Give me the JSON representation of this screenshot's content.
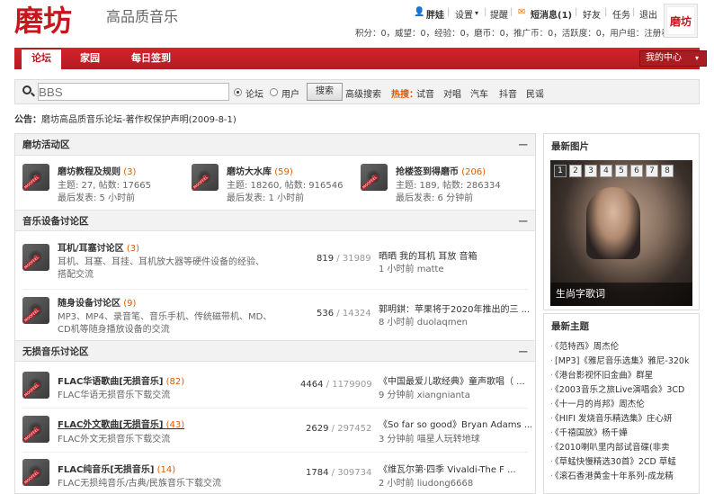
{
  "header": {
    "logo_text": "磨坊",
    "subtitle": "高品质音乐",
    "user": "胖娃",
    "menu": [
      "设置",
      "提醒",
      "短消息(1)",
      "好友",
      "任务",
      "退出"
    ],
    "stats": "积分：0，威望：0，经验：0，磨币：0，推广币：0，活跃度：0，用户组：注册看看",
    "avatar_text": "磨坊"
  },
  "nav": {
    "items": [
      "论坛",
      "家园",
      "每日签到"
    ],
    "my_center": "我的中心"
  },
  "search": {
    "placeholder": "BBS",
    "opt_forum": "论坛",
    "opt_user": "用户",
    "button": "搜索",
    "advanced": "高级搜索",
    "hot_label": "热搜：",
    "hot": [
      "试音",
      "对唱",
      "汽车",
      "抖音",
      "民谣"
    ]
  },
  "notice": {
    "label": "公告：",
    "text": "磨坊高品质音乐论坛-著作权保护声明(2009-8-1)"
  },
  "sec1": {
    "title": "磨坊活动区",
    "forums": [
      {
        "name": "磨坊教程及规则",
        "count": "(3)",
        "stats": "主题: 27, 帖数: 17665",
        "last": "最后发表: 5 小时前"
      },
      {
        "name": "磨坊大水库",
        "count": "(59)",
        "stats": "主题: 18260, 帖数: 916546",
        "last": "最后发表: 1 小时前"
      },
      {
        "name": "抢楼签到得磨币",
        "count": "(206)",
        "stats": "主题: 189, 帖数: 286334",
        "last": "最后发表: 6 分钟前"
      }
    ]
  },
  "sec2": {
    "title": "音乐设备讨论区",
    "forums": [
      {
        "name": "耳机/耳塞讨论区",
        "count": "(3)",
        "desc1": "耳机、耳塞、耳挂、耳机放大器等硬件设备的经验、",
        "desc2": "搭配交流",
        "topics": "819",
        "posts": "31989",
        "lt": "晒晒 我的耳机 耳放 音箱",
        "lm": "1 小时前 matte"
      },
      {
        "name": "随身设备讨论区",
        "count": "(9)",
        "desc1": "MP3、MP4、录音笔、音乐手机、传统磁带机、MD、",
        "desc2": "CD机等随身播放设备的交流",
        "topics": "536",
        "posts": "14324",
        "lt": "郭明錤：苹果将于2020年推出的三 ...",
        "lm": "8 小时前 duolaqmen"
      }
    ]
  },
  "sec3": {
    "title": "无损音乐讨论区",
    "forums": [
      {
        "name": "FLAC华语歌曲[无损音乐]",
        "count": "(82)",
        "desc1": "FLAC华语无损音乐下载交流",
        "topics": "4464",
        "posts": "1179909",
        "lt": "《中国最爱儿歌经典》童声歌唱（ ...",
        "lm": "9 分钟前 xiangnianta"
      },
      {
        "name": "FLAC外文歌曲[无损音乐]",
        "count": "(43)",
        "desc1": "FLAC外文无损音乐下载交流",
        "topics": "2629",
        "posts": "297452",
        "lt": "《So far so good》Bryan Adams ...",
        "lm": "3 分钟前 喵星人玩转地球"
      },
      {
        "name": "FLAC纯音乐[无损音乐]",
        "count": "(14)",
        "desc1": "FLAC无损纯音乐/古典/民族音乐下载交流",
        "topics": "1784",
        "posts": "309734",
        "lt": "《维瓦尔第·四季 Vivaldi-The F ...",
        "lm": "2 小时前 liudong6668"
      }
    ]
  },
  "side": {
    "pic_title": "最新图片",
    "pic_nums": [
      "1",
      "2",
      "3",
      "4",
      "5",
      "6",
      "7",
      "8"
    ],
    "pic_caption": "生尚字歌词",
    "new_title": "最新主题",
    "topics": [
      "《范特西》周杰伦",
      "[MP3]《雅尼音乐选集》雅尼-320k",
      "《港台影视怀旧金曲》群星",
      "《2003音乐之旅Live演唱会》3CD",
      "《十一月的肖邦》周杰伦",
      "《HIFI 发烧音乐精选集》庄心妍",
      "《千禧国放》杨千嬅",
      "《2010喇叭里内部试音碟(非卖",
      "《草蜢快慢精选30首》2CD 草蜢",
      "《滚石香港黄金十年系列-成龙精"
    ]
  }
}
